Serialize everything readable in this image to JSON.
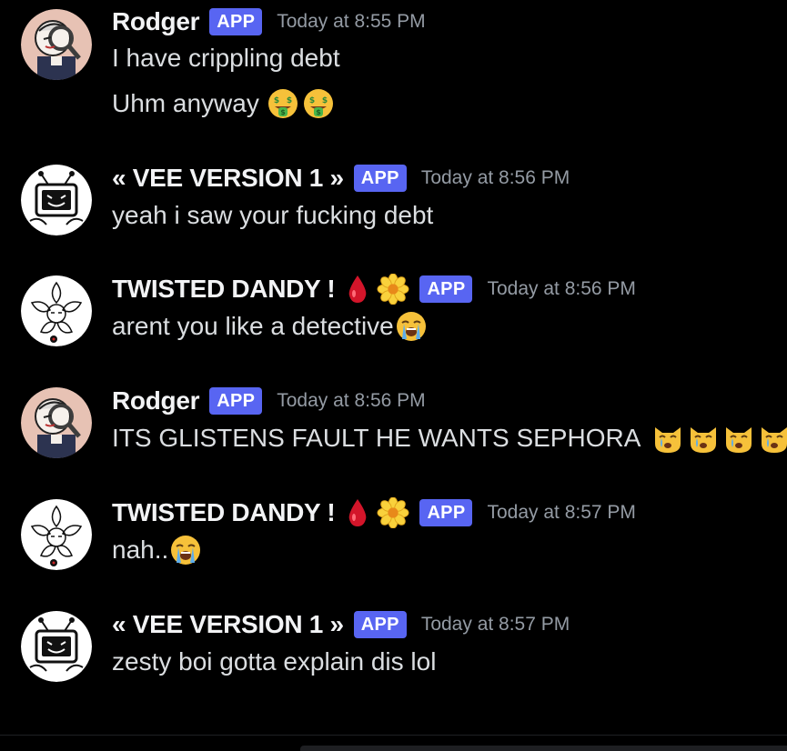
{
  "colors": {
    "background": "#000000",
    "username": "#f2f3f5",
    "message_text": "#dbdee1",
    "app_badge": "#5865f2",
    "timestamp": "#949ba4"
  },
  "messages": [
    {
      "username": "Rodger",
      "badge": "APP",
      "timestamp": "Today at 8:55 PM",
      "avatar_icon": "detective-magnifier-avatar",
      "lines": [
        "I have crippling debt",
        "Uhm anyway"
      ],
      "line_emojis": [
        [],
        [
          "money-mouth-face-emoji",
          "money-mouth-face-emoji"
        ]
      ]
    },
    {
      "username": "« VEE VERSION 1 »",
      "badge": "APP",
      "timestamp": "Today at 8:56 PM",
      "avatar_icon": "tv-head-avatar",
      "lines": [
        "yeah i saw your fucking debt"
      ]
    },
    {
      "username": "TWISTED DANDY !",
      "badge": "APP",
      "timestamp": "Today at 8:56 PM",
      "avatar_icon": "flower-sketch-avatar",
      "name_decorations": [
        "blood-drop-emoji",
        "blossom-emoji"
      ],
      "lines": [
        "arent you like a detective"
      ],
      "line_emojis": [
        [
          "loudly-crying-face-emoji"
        ]
      ]
    },
    {
      "username": "Rodger",
      "badge": "APP",
      "timestamp": "Today at 8:56 PM",
      "avatar_icon": "detective-magnifier-avatar",
      "lines": [
        "ITS GLISTENS FAULT HE WANTS SEPHORA"
      ],
      "line_emojis": [
        [
          "crying-cat-face-emoji",
          "crying-cat-face-emoji",
          "crying-cat-face-emoji",
          "crying-cat-face-emoji"
        ]
      ]
    },
    {
      "username": "TWISTED DANDY !",
      "badge": "APP",
      "timestamp": "Today at 8:57 PM",
      "avatar_icon": "flower-sketch-avatar",
      "name_decorations": [
        "blood-drop-emoji",
        "blossom-emoji"
      ],
      "lines": [
        "nah.."
      ],
      "line_emojis": [
        [
          "loudly-crying-face-emoji"
        ]
      ]
    },
    {
      "username": "« VEE VERSION 1 »",
      "badge": "APP",
      "timestamp": "Today at 8:57 PM",
      "avatar_icon": "tv-head-avatar",
      "lines": [
        "zesty boi gotta explain dis lol"
      ]
    }
  ]
}
